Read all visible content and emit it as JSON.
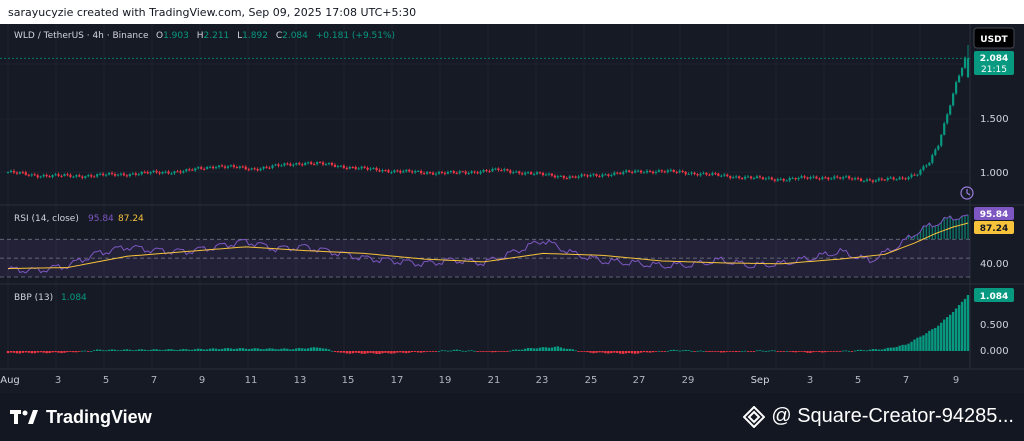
{
  "header": {
    "caption": "sarayucyzie created with TradingView.com, Sep 09, 2025 17:08 UTC+5:30"
  },
  "footer": {
    "brand": "TradingView",
    "watermark": "@ Square-Creator-94285..."
  },
  "legend": {
    "symbol": "WLD / TetherUS · 4h · Binance",
    "o_label": "O",
    "o_value": "1.903",
    "h_label": "H",
    "h_value": "2.211",
    "l_label": "L",
    "l_value": "1.892",
    "c_label": "C",
    "c_value": "2.084",
    "change": "+0.181 (+9.51%)"
  },
  "currency_button": "USDT",
  "price_label": {
    "value": "2.084",
    "countdown": "21:15"
  },
  "rsi_legend": {
    "name": "RSI (14, close)",
    "rsi": "95.84",
    "ma": "87.24"
  },
  "bbp_legend": {
    "name": "BBP (13)",
    "value": "1.084"
  },
  "colors": {
    "up": "#089981",
    "down": "#f23645",
    "rsi": "#7e57c2",
    "rsi_ma": "#f7c33b",
    "background": "#161a25"
  },
  "chart_data": [
    {
      "type": "candlestick",
      "title": "WLD / TetherUS · 4h · Binance",
      "y_ticks": [
        "1.000",
        "1.500",
        "2.084"
      ],
      "ylim": [
        0.9,
        2.3
      ],
      "x_ticks": [
        "Aug",
        "3",
        "5",
        "7",
        "9",
        "11",
        "13",
        "15",
        "17",
        "19",
        "21",
        "23",
        "25",
        "27",
        "29",
        "Sep",
        "3",
        "5",
        "7",
        "9"
      ],
      "close_path": [
        [
          0,
          0.99
        ],
        [
          8,
          0.96
        ],
        [
          22,
          0.95
        ],
        [
          40,
          0.97
        ],
        [
          60,
          1.0
        ],
        [
          70,
          1.05
        ],
        [
          82,
          1.02
        ],
        [
          100,
          1.08
        ],
        [
          108,
          1.06
        ],
        [
          120,
          1.02
        ],
        [
          135,
          0.99
        ],
        [
          150,
          0.98
        ],
        [
          165,
          1.01
        ],
        [
          178,
          0.97
        ],
        [
          190,
          0.94
        ],
        [
          202,
          0.97
        ],
        [
          214,
          1.0
        ],
        [
          226,
          0.99
        ],
        [
          238,
          0.96
        ],
        [
          252,
          0.93
        ],
        [
          262,
          0.92
        ],
        [
          272,
          0.94
        ],
        [
          282,
          0.93
        ],
        [
          292,
          0.91
        ],
        [
          301,
          0.93
        ],
        [
          306,
          0.98
        ],
        [
          310,
          1.08
        ],
        [
          313,
          1.25
        ],
        [
          316,
          1.55
        ],
        [
          319,
          1.85
        ],
        [
          322,
          2.08
        ],
        [
          323,
          2.084
        ]
      ],
      "open": 1.903,
      "high": 2.211,
      "low": 1.892,
      "close": 2.084
    },
    {
      "type": "line",
      "title": "RSI (14, close)",
      "ylim": [
        30,
        100
      ],
      "y_ticks": [
        "40.00"
      ],
      "band": [
        30,
        70
      ],
      "series": [
        {
          "name": "RSI",
          "points": [
            [
              0,
              38
            ],
            [
              10,
              37
            ],
            [
              20,
              42
            ],
            [
              30,
              55
            ],
            [
              40,
              62
            ],
            [
              50,
              58
            ],
            [
              60,
              57
            ],
            [
              70,
              62
            ],
            [
              80,
              68
            ],
            [
              90,
              60
            ],
            [
              100,
              62
            ],
            [
              110,
              56
            ],
            [
              120,
              50
            ],
            [
              130,
              47
            ],
            [
              140,
              44
            ],
            [
              150,
              48
            ],
            [
              160,
              45
            ],
            [
              170,
              56
            ],
            [
              180,
              69
            ],
            [
              190,
              55
            ],
            [
              200,
              47
            ],
            [
              210,
              45
            ],
            [
              220,
              42
            ],
            [
              230,
              43
            ],
            [
              240,
              48
            ],
            [
              250,
              42
            ],
            [
              260,
              44
            ],
            [
              270,
              50
            ],
            [
              280,
              57
            ],
            [
              290,
              47
            ],
            [
              300,
              64
            ],
            [
              305,
              76
            ],
            [
              310,
              84
            ],
            [
              315,
              90
            ],
            [
              320,
              94
            ],
            [
              323,
              95.84
            ]
          ]
        },
        {
          "name": "MA",
          "points": [
            [
              0,
              39
            ],
            [
              20,
              40
            ],
            [
              40,
              52
            ],
            [
              60,
              57
            ],
            [
              80,
              62
            ],
            [
              100,
              58
            ],
            [
              120,
              55
            ],
            [
              140,
              49
            ],
            [
              160,
              46
            ],
            [
              180,
              55
            ],
            [
              200,
              53
            ],
            [
              220,
              47
            ],
            [
              240,
              45
            ],
            [
              260,
              44
            ],
            [
              280,
              49
            ],
            [
              295,
              54
            ],
            [
              305,
              66
            ],
            [
              312,
              76
            ],
            [
              318,
              83
            ],
            [
              323,
              87.24
            ]
          ]
        }
      ]
    },
    {
      "type": "bar",
      "title": "BBP (13)",
      "ylim": [
        -0.15,
        1.15
      ],
      "y_ticks": [
        "1.084",
        "0.500",
        "0.000"
      ],
      "profile": [
        [
          0,
          -0.04
        ],
        [
          20,
          -0.03
        ],
        [
          30,
          0.02
        ],
        [
          60,
          0.03
        ],
        [
          75,
          0.05
        ],
        [
          95,
          0.04
        ],
        [
          105,
          0.07
        ],
        [
          112,
          -0.04
        ],
        [
          125,
          -0.05
        ],
        [
          140,
          -0.02
        ],
        [
          150,
          0.02
        ],
        [
          165,
          -0.02
        ],
        [
          175,
          0.05
        ],
        [
          185,
          0.08
        ],
        [
          195,
          -0.03
        ],
        [
          210,
          -0.05
        ],
        [
          225,
          0.02
        ],
        [
          240,
          -0.02
        ],
        [
          255,
          0.01
        ],
        [
          270,
          -0.03
        ],
        [
          285,
          0.01
        ],
        [
          295,
          0.04
        ],
        [
          302,
          0.12
        ],
        [
          307,
          0.28
        ],
        [
          312,
          0.45
        ],
        [
          316,
          0.65
        ],
        [
          320,
          0.88
        ],
        [
          323,
          1.084
        ]
      ]
    }
  ]
}
